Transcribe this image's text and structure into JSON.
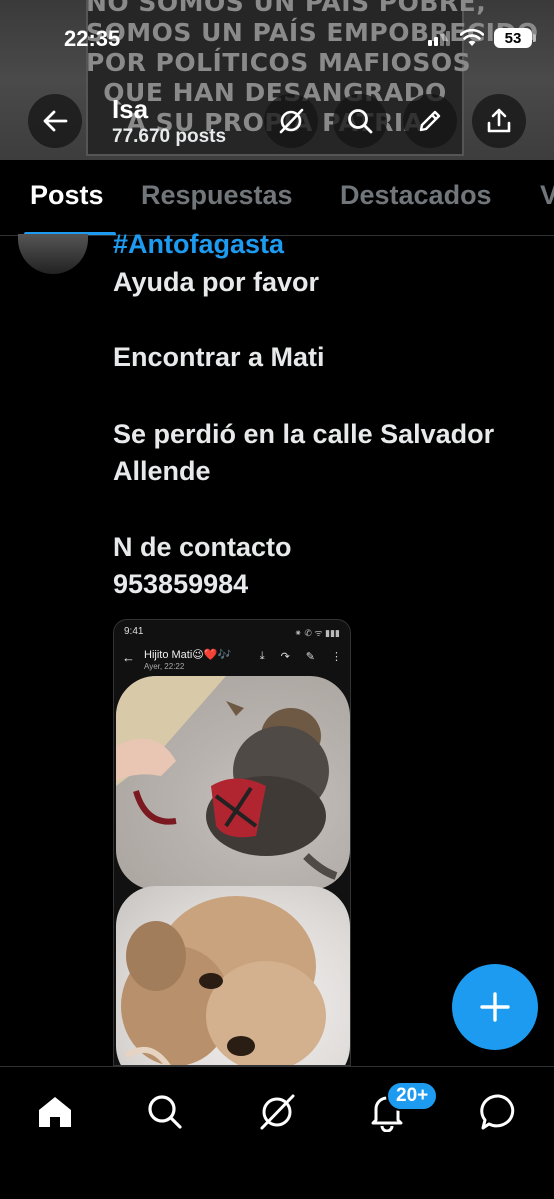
{
  "status_bar": {
    "time": "22:35",
    "battery": "53"
  },
  "banner": {
    "lines": [
      "NO SOMOS UN PAÍS POBRE,",
      "SOMOS UN PAÍS EMPOBRECIDO",
      "POR POLÍTICOS MAFIOSOS",
      "QUE HAN DESANGRADO",
      "A SU PROPIA PATRIA"
    ]
  },
  "profile": {
    "name": "Isa",
    "post_count": "77.670 posts"
  },
  "header_icons": [
    "back-arrow-icon",
    "grok-icon",
    "search-icon",
    "edit-icon",
    "share-icon"
  ],
  "tabs": [
    {
      "label": "Posts"
    },
    {
      "label": "Respuestas"
    },
    {
      "label": "Destacados"
    },
    {
      "label": "V"
    }
  ],
  "post": {
    "hashtag": "#Antofagasta",
    "lines": [
      "Ayuda por favor",
      "Encontrar a Mati",
      "Se perdió en la calle Salvador",
      "Allende",
      "N de contacto",
      "953859984"
    ]
  },
  "media": {
    "status_time": "9:41",
    "status_right": "⁕ ✆ ᯤ ▮▮▮",
    "chat_title": "Hijito Mati😉❤️🎶",
    "chat_subtitle": "Ayer, 22:22",
    "back": "←",
    "tools": [
      "⤓",
      "↷",
      "✎",
      "⋮"
    ]
  },
  "fab": {
    "icon": "plus-icon"
  },
  "bottom_nav": {
    "notification_badge": "20+"
  },
  "colors": {
    "accent": "#1d9bf0",
    "background": "#000000",
    "text": "#e7e9ea",
    "muted": "#71767b"
  }
}
